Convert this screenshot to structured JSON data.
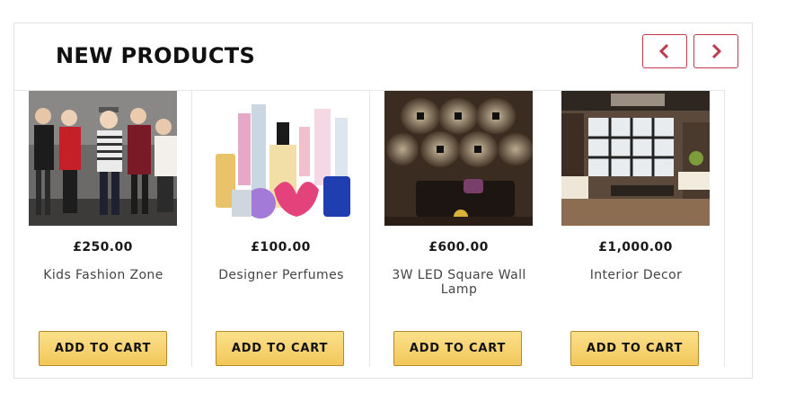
{
  "section": {
    "title": "NEW PRODUCTS",
    "prev_icon": "chevron-left-icon",
    "next_icon": "chevron-right-icon",
    "accent_color": "#c0394d",
    "button_color": "#f2c75a"
  },
  "products": [
    {
      "price": "£250.00",
      "name": "Kids Fashion Zone",
      "cta": "ADD TO CART",
      "image": "kids-fashion-photo"
    },
    {
      "price": "£100.00",
      "name": "Designer Perfumes",
      "cta": "ADD TO CART",
      "image": "perfume-bottles-photo"
    },
    {
      "price": "£600.00",
      "name": "3W LED Square Wall Lamp",
      "cta": "ADD TO CART",
      "image": "wall-lamp-photo"
    },
    {
      "price": "£1,000.00",
      "name": "Interior Decor",
      "cta": "ADD TO CART",
      "image": "living-room-photo"
    }
  ]
}
